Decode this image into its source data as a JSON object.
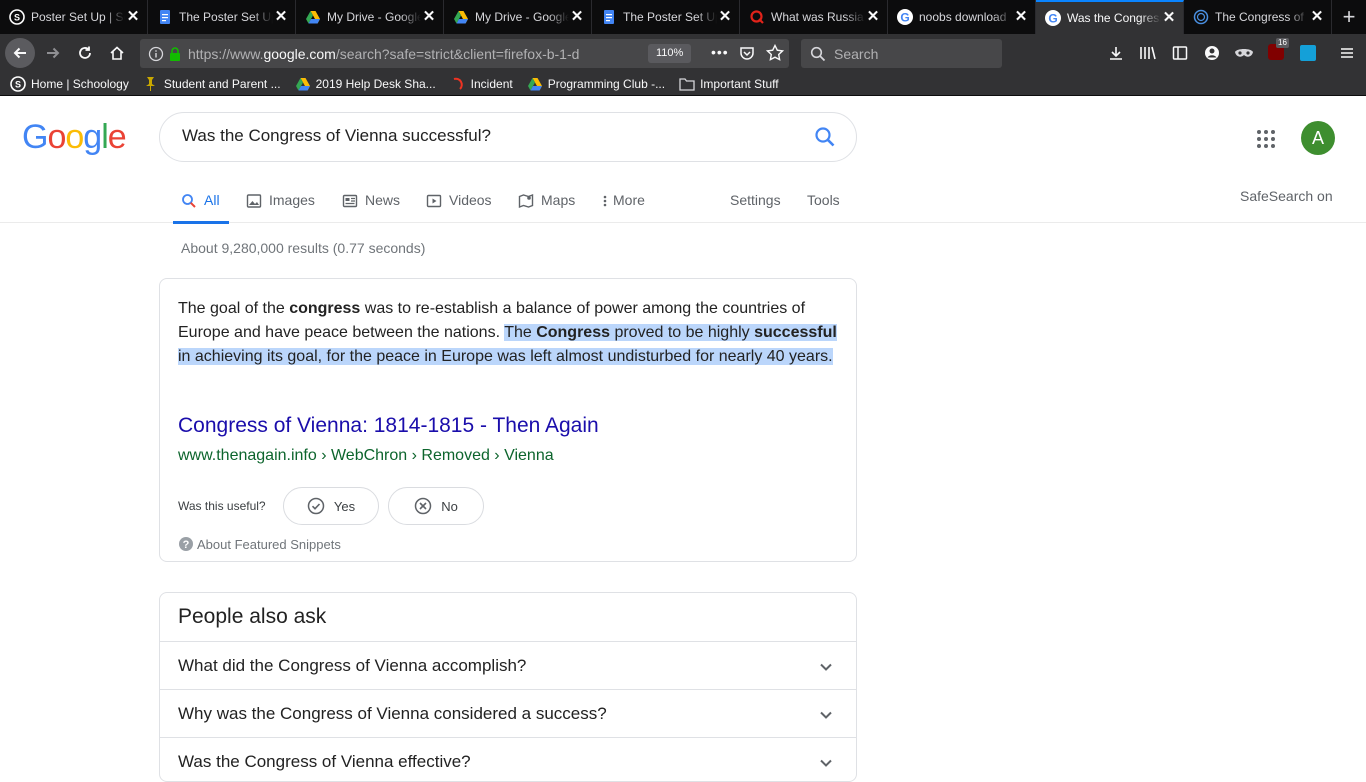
{
  "browser": {
    "tabs": [
      {
        "title": "Poster Set Up | Schoology",
        "favicon": "schoology-icon",
        "active": false
      },
      {
        "title": "The Poster Set Up - Google Docs",
        "favicon": "google-docs-icon",
        "active": false
      },
      {
        "title": "My Drive - Google Drive",
        "favicon": "google-drive-icon",
        "active": false
      },
      {
        "title": "My Drive - Google Drive",
        "favicon": "google-drive-icon",
        "active": false
      },
      {
        "title": "The Poster Set Up - Google Docs",
        "favicon": "google-docs-icon",
        "active": false
      },
      {
        "title": "What was Russia",
        "favicon": "quizlet-icon",
        "active": false
      },
      {
        "title": "noobs download",
        "favicon": "google-icon",
        "active": false
      },
      {
        "title": "Was the Congress",
        "favicon": "google-icon",
        "active": true
      },
      {
        "title": "The Congress of",
        "favicon": "globe-icon",
        "active": false
      }
    ],
    "tab_close_glyph": "✕",
    "new_tab_glyph": "+",
    "url_prefix": "https://www.",
    "url_domain": "google.com",
    "url_rest": "/search?safe=strict&client=firefox-b-1-d",
    "zoom": "110%",
    "search_placeholder": "Search",
    "extension_badge": "16",
    "bookmarks": [
      {
        "label": "Home | Schoology",
        "icon": "schoology-icon"
      },
      {
        "label": "Student and Parent ...",
        "icon": "pin-icon"
      },
      {
        "label": "2019 Help Desk Sha...",
        "icon": "google-drive-icon"
      },
      {
        "label": "Incident",
        "icon": "incident-icon"
      },
      {
        "label": "Programming Club -...",
        "icon": "google-drive-icon"
      },
      {
        "label": "Important Stuff",
        "icon": "folder-icon"
      }
    ]
  },
  "google": {
    "logo": [
      "G",
      "o",
      "o",
      "g",
      "l",
      "e"
    ],
    "logo_colors": [
      "#4285f4",
      "#ea4335",
      "#fbbc05",
      "#4285f4",
      "#34a853",
      "#ea4335"
    ],
    "query": "Was the Congress of Vienna successful?",
    "avatar_letter": "A",
    "nav_tabs": {
      "all": "All",
      "images": "Images",
      "news": "News",
      "videos": "Videos",
      "maps": "Maps",
      "more": "More",
      "settings": "Settings",
      "tools": "Tools"
    },
    "safesearch": "SafeSearch on",
    "result_stats": "About 9,280,000 results (0.77 seconds)",
    "snippet": {
      "t1": "The goal of the ",
      "t2": "congress",
      "t3": " was to re-establish a balance of power among the countries of Europe and have peace between the nations. ",
      "t4": "The ",
      "t5": "Congress",
      "t6": " proved to be highly ",
      "t7": "successful",
      "t8": " in achieving its goal, for the peace in Europe was left almost undisturbed for nearly 40 years.",
      "source_title": "Congress of Vienna: 1814-1815 - Then Again",
      "source_cite": "www.thenagain.info › WebChron › Removed › Vienna",
      "useful_label": "Was this useful?",
      "yes_label": "Yes",
      "no_label": "No",
      "about_label": "About Featured Snippets"
    },
    "people_also_ask": {
      "title": "People also ask",
      "questions": [
        "What did the Congress of Vienna accomplish?",
        "Why was the Congress of Vienna considered a success?",
        "Was the Congress of Vienna effective?"
      ]
    },
    "accent_blue": "#1a73e8",
    "link_color": "#1a0dab",
    "cite_color": "#0d652d",
    "highlight_color": "#bbd6fb"
  }
}
